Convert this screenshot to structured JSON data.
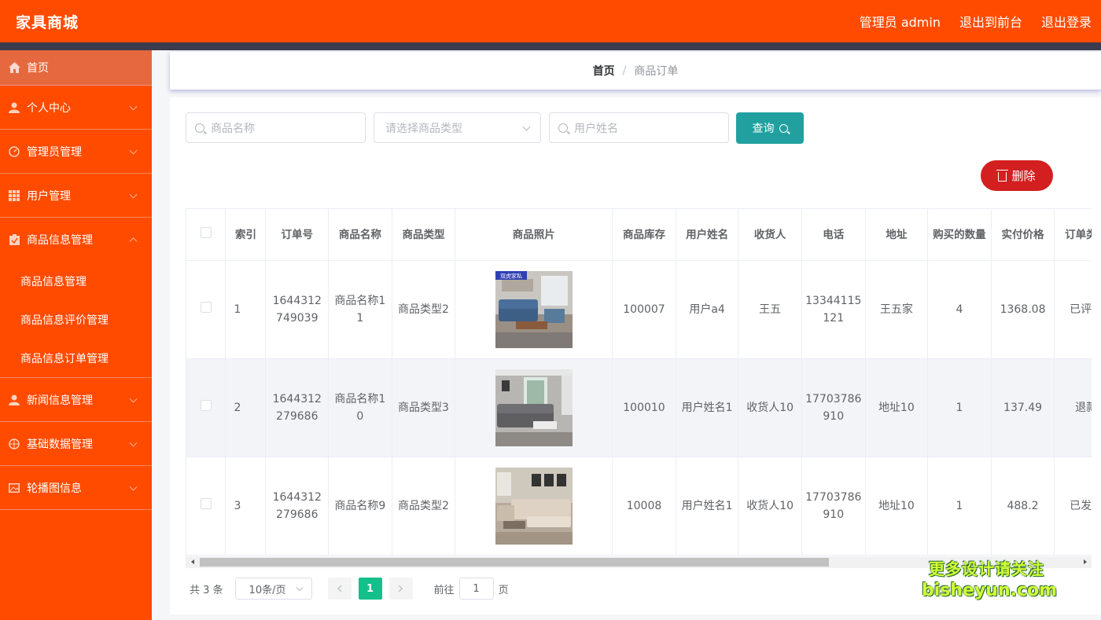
{
  "header": {
    "brand": "家具商城",
    "admin_label": "管理员 admin",
    "to_front": "退出到前台",
    "logout": "退出登录"
  },
  "sidebar": {
    "items": [
      {
        "label": "首页",
        "icon": "home-icon"
      },
      {
        "label": "个人中心",
        "icon": "user-icon"
      },
      {
        "label": "管理员管理",
        "icon": "dashboard-icon"
      },
      {
        "label": "用户管理",
        "icon": "grid-icon"
      },
      {
        "label": "商品信息管理",
        "icon": "clipboard-icon",
        "expanded": true,
        "children": [
          "商品信息管理",
          "商品信息评价管理",
          "商品信息订单管理"
        ]
      },
      {
        "label": "新闻信息管理",
        "icon": "user-icon"
      },
      {
        "label": "基础数据管理",
        "icon": "compass-icon"
      },
      {
        "label": "轮播图信息",
        "icon": "picture-icon"
      }
    ]
  },
  "breadcrumb": {
    "home": "首页",
    "separator": "/",
    "current": "商品订单"
  },
  "search": {
    "goods_name_placeholder": "商品名称",
    "goods_type_placeholder": "请选择商品类型",
    "user_name_placeholder": "用户姓名",
    "query_label": "查询"
  },
  "delete_label": "删除",
  "table": {
    "columns": [
      "索引",
      "订单号",
      "商品名称",
      "商品类型",
      "商品照片",
      "商品库存",
      "用户姓名",
      "收货人",
      "电话",
      "地址",
      "购买的数量",
      "实付价格",
      "订单类型"
    ],
    "rows": [
      {
        "index": "1",
        "order_no": "1644312749039",
        "goods_name": "商品名称11",
        "goods_type": "商品类型2",
        "photo": "sofa-blue",
        "stock": "100007",
        "user_name": "用户a4",
        "receiver": "王五",
        "phone": "13344115121",
        "address": "王五家",
        "quantity": "4",
        "price": "1368.08",
        "order_type": "已评价"
      },
      {
        "index": "2",
        "order_no": "1644312279686",
        "goods_name": "商品名称10",
        "goods_type": "商品类型3",
        "photo": "sofa-grey",
        "stock": "100010",
        "user_name": "用户姓名1",
        "receiver": "收货人10",
        "phone": "17703786910",
        "address": "地址10",
        "quantity": "1",
        "price": "137.49",
        "order_type": "退款"
      },
      {
        "index": "3",
        "order_no": "1644312279686",
        "goods_name": "商品名称9",
        "goods_type": "商品类型2",
        "photo": "sofa-beige",
        "stock": "10008",
        "user_name": "用户姓名1",
        "receiver": "收货人10",
        "phone": "17703786910",
        "address": "地址10",
        "quantity": "1",
        "price": "488.2",
        "order_type": "已发货"
      }
    ]
  },
  "photo_badge": "双虎家私",
  "pagination": {
    "total": "共 3 条",
    "page_size": "10条/页",
    "current_page": "1",
    "goto_prefix": "前往",
    "goto_value": "1",
    "goto_suffix": "页"
  },
  "watermark": {
    "line1": "更多设计请关注",
    "line2": "bisheyun.com"
  },
  "colors": {
    "primary": "#ff4b00",
    "query_button": "#22a0a0",
    "delete_button": "#d31f1f",
    "page_active": "#13c08a"
  }
}
